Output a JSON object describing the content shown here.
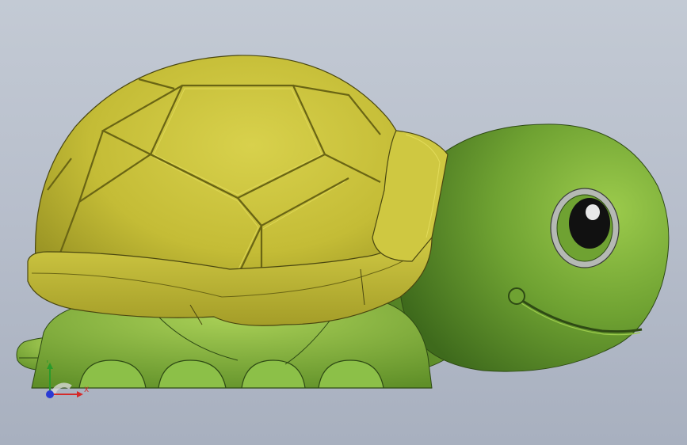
{
  "viewport": {
    "background_top": "#c3cad4",
    "background_bottom": "#a8b0bf"
  },
  "model": {
    "subject": "turtle",
    "shell_color": "#c9c23a",
    "body_color": "#7fb23c",
    "eye_ring_color": "#b5b9b4"
  },
  "triad": {
    "x_label": "X",
    "y_label": "Y",
    "x_color": "#d42a2a",
    "y_color": "#2a9a2a",
    "z_color": "#2a3ad4"
  }
}
